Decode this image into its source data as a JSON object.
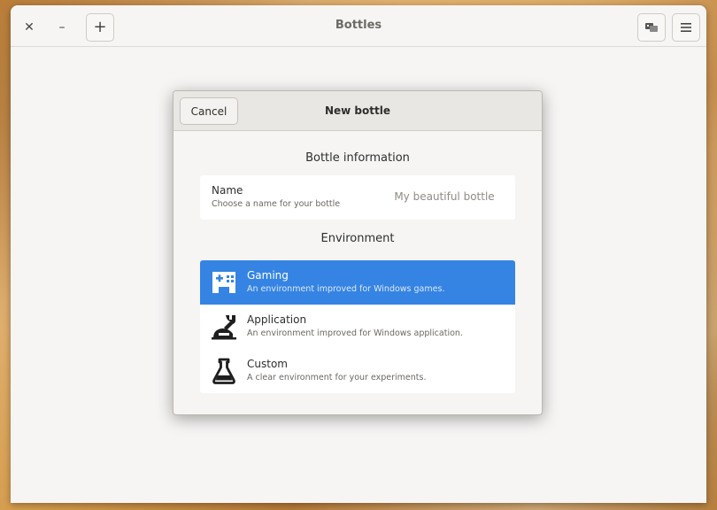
{
  "app": {
    "title": "Bottles",
    "close_glyph": "✕",
    "minimize_glyph": "–",
    "add_glyph": "+"
  },
  "dialog": {
    "title": "New bottle",
    "cancel_label": "Cancel",
    "info_section_title": "Bottle information",
    "name": {
      "label": "Name",
      "description": "Choose a name for your bottle",
      "placeholder": "My beautiful bottle",
      "value": ""
    },
    "environment_section_title": "Environment",
    "environments": [
      {
        "label": "Gaming",
        "description": "An environment improved for Windows games.",
        "icon": "gamepad-icon",
        "selected": true
      },
      {
        "label": "Application",
        "description": "An environment improved for Windows application.",
        "icon": "wrench-icon",
        "selected": false
      },
      {
        "label": "Custom",
        "description": "A clear environment for your experiments.",
        "icon": "flask-icon",
        "selected": false
      }
    ]
  },
  "colors": {
    "accent": "#3584e4",
    "window_bg": "#f6f5f4",
    "card_bg": "#ffffff"
  }
}
